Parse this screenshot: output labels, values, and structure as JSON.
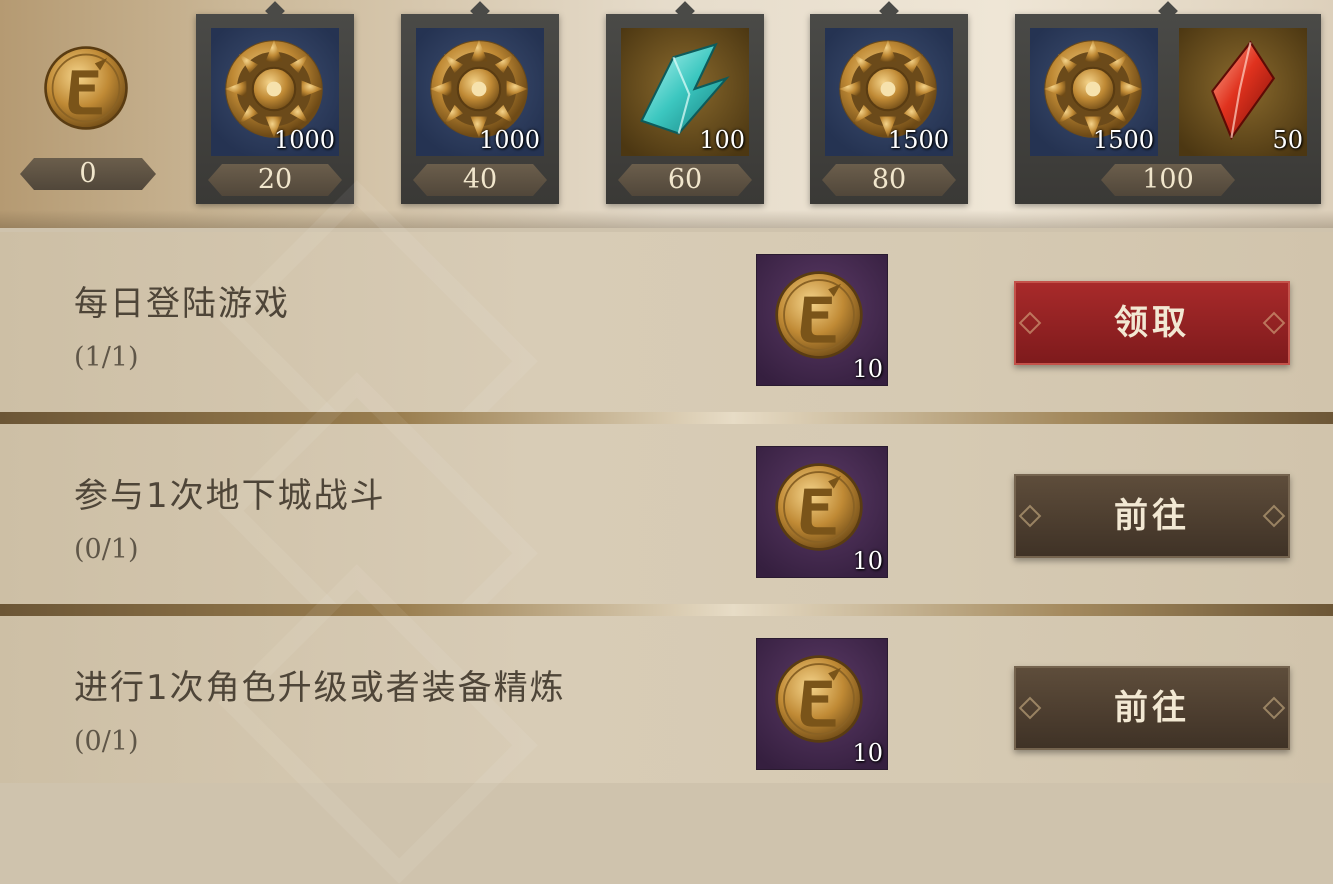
{
  "progress": {
    "current_points": "0",
    "milestones": [
      {
        "points": "20",
        "rewards": [
          {
            "icon": "gold-wheel-coin-icon",
            "qty": "1000",
            "bg": "blue"
          }
        ]
      },
      {
        "points": "40",
        "rewards": [
          {
            "icon": "gold-wheel-coin-icon",
            "qty": "1000",
            "bg": "blue"
          }
        ]
      },
      {
        "points": "60",
        "rewards": [
          {
            "icon": "cyan-crystal-shard-icon",
            "qty": "100",
            "bg": "gold"
          }
        ]
      },
      {
        "points": "80",
        "rewards": [
          {
            "icon": "gold-wheel-coin-icon",
            "qty": "1500",
            "bg": "blue"
          }
        ]
      },
      {
        "points": "100",
        "rewards": [
          {
            "icon": "gold-wheel-coin-icon",
            "qty": "1500",
            "bg": "blue"
          },
          {
            "icon": "red-crystal-icon",
            "qty": "50",
            "bg": "gold"
          }
        ]
      }
    ]
  },
  "tasks": [
    {
      "title": "每日登陆游戏",
      "progress": "(1/1)",
      "reward_icon": "activity-token-icon",
      "reward_qty": "10",
      "button": "领取",
      "button_style": "claim"
    },
    {
      "title": "参与1次地下城战斗",
      "progress": "(0/1)",
      "reward_icon": "activity-token-icon",
      "reward_qty": "10",
      "button": "前往",
      "button_style": "go"
    },
    {
      "title": "进行1次角色升级或者装备精炼",
      "progress": "(0/1)",
      "reward_icon": "activity-token-icon",
      "reward_qty": "10",
      "button": "前往",
      "button_style": "go"
    }
  ],
  "colors": {
    "claim_button": "#9b2426",
    "go_button": "#4f3f30",
    "reward_bg": "#432a4e",
    "card_bg": "#42413e"
  }
}
